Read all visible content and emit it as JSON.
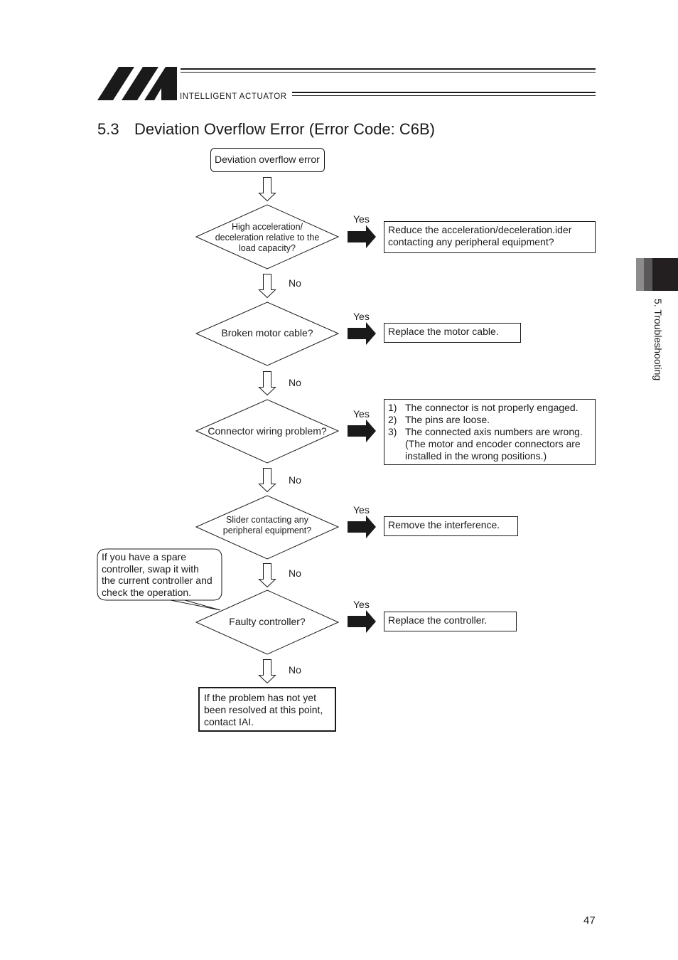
{
  "header": {
    "brand": "INTELLIGENT ACTUATOR",
    "logo": "iai-logo-icon"
  },
  "section": {
    "number": "5.3",
    "title": "Deviation Overflow Error (Error Code: C6B)"
  },
  "side_tab": {
    "label": "5. Troubleshooting",
    "colors": [
      "#8c8c8c",
      "#5a5858",
      "#231f20"
    ]
  },
  "flowchart": {
    "start": "Deviation overflow error",
    "yes_label": "Yes",
    "no_label": "No",
    "decisions": [
      {
        "question": "High acceleration/ deceleration relative to the load capacity?",
        "question_lines": [
          "High acceleration/",
          "deceleration relative to the",
          "load capacity?"
        ],
        "action_lines": [
          "Reduce the acceleration/deceleration.ider",
          "contacting any peripheral equipment?"
        ]
      },
      {
        "question": "Broken motor cable?",
        "question_lines": [
          "Broken motor cable?"
        ],
        "action_lines": [
          "Replace the motor cable."
        ]
      },
      {
        "question": "Connector wiring problem?",
        "question_lines": [
          "Connector wiring problem?"
        ],
        "action_list": [
          {
            "n": "1)",
            "text": "The connector is not properly engaged."
          },
          {
            "n": "2)",
            "text": "The pins are loose."
          },
          {
            "n": "3)",
            "text": "The connected axis numbers are wrong."
          },
          {
            "n": "",
            "text": "(The motor and encoder connectors are"
          },
          {
            "n": "",
            "text": "installed in the wrong positions.)"
          }
        ]
      },
      {
        "question": "Slider contacting any peripheral equipment?",
        "question_lines": [
          "Slider contacting any",
          "peripheral equipment?"
        ],
        "action_lines": [
          "Remove the interference."
        ]
      },
      {
        "question": "Faulty controller?",
        "question_lines": [
          "Faulty controller?"
        ],
        "action_lines": [
          "Replace the controller."
        ]
      }
    ],
    "callout_lines": [
      "If you have a spare",
      "controller, swap it with",
      "the current controller and",
      "check the operation."
    ],
    "end_lines": [
      "If the problem has not yet",
      "been resolved at this point,",
      "contact IAI."
    ]
  },
  "page_number": "47"
}
